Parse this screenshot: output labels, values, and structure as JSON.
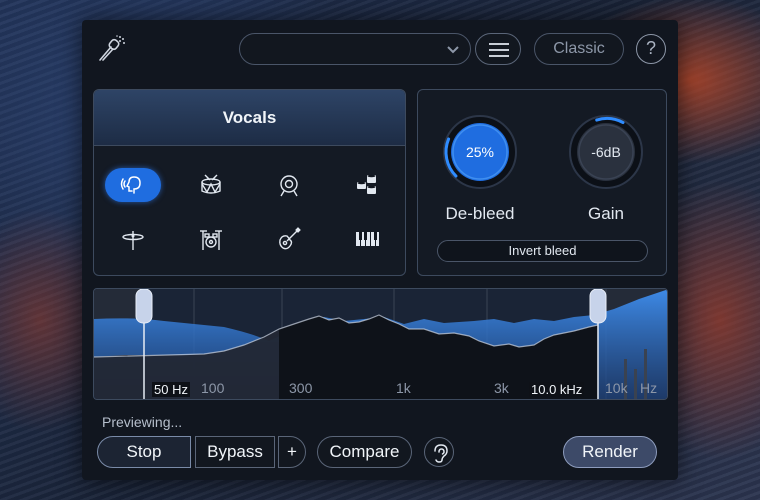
{
  "header": {
    "preset_value": "",
    "classic_label": "Classic",
    "help_label": "?"
  },
  "source": {
    "title": "Vocals",
    "instruments": [
      {
        "icon": "vocals-icon",
        "active": true
      },
      {
        "icon": "drum-icon",
        "active": false
      },
      {
        "icon": "bass-drum-icon",
        "active": false
      },
      {
        "icon": "percussion-icon",
        "active": false
      },
      {
        "icon": "cymbal-icon",
        "active": false
      },
      {
        "icon": "drum-kit-icon",
        "active": false
      },
      {
        "icon": "guitar-icon",
        "active": false
      },
      {
        "icon": "piano-icon",
        "active": false
      }
    ]
  },
  "knobs": {
    "debleed": {
      "label": "De-bleed",
      "value": "25%",
      "level": 0.25
    },
    "gain": {
      "label": "Gain",
      "value": "-6dB"
    },
    "invert_label": "Invert bleed"
  },
  "spectrum": {
    "labels": [
      "50 Hz",
      "100",
      "300",
      "1k",
      "3k",
      "10.0 kHz",
      "10k",
      "Hz"
    ],
    "low_cut": "50 Hz",
    "high_cut": "10.0 kHz"
  },
  "transport": {
    "status": "Previewing...",
    "stop_label": "Stop",
    "bypass_label": "Bypass",
    "plus_label": "+",
    "compare_label": "Compare",
    "render_label": "Render"
  },
  "colors": {
    "accent": "#1f6de0",
    "panel": "#11161f"
  }
}
